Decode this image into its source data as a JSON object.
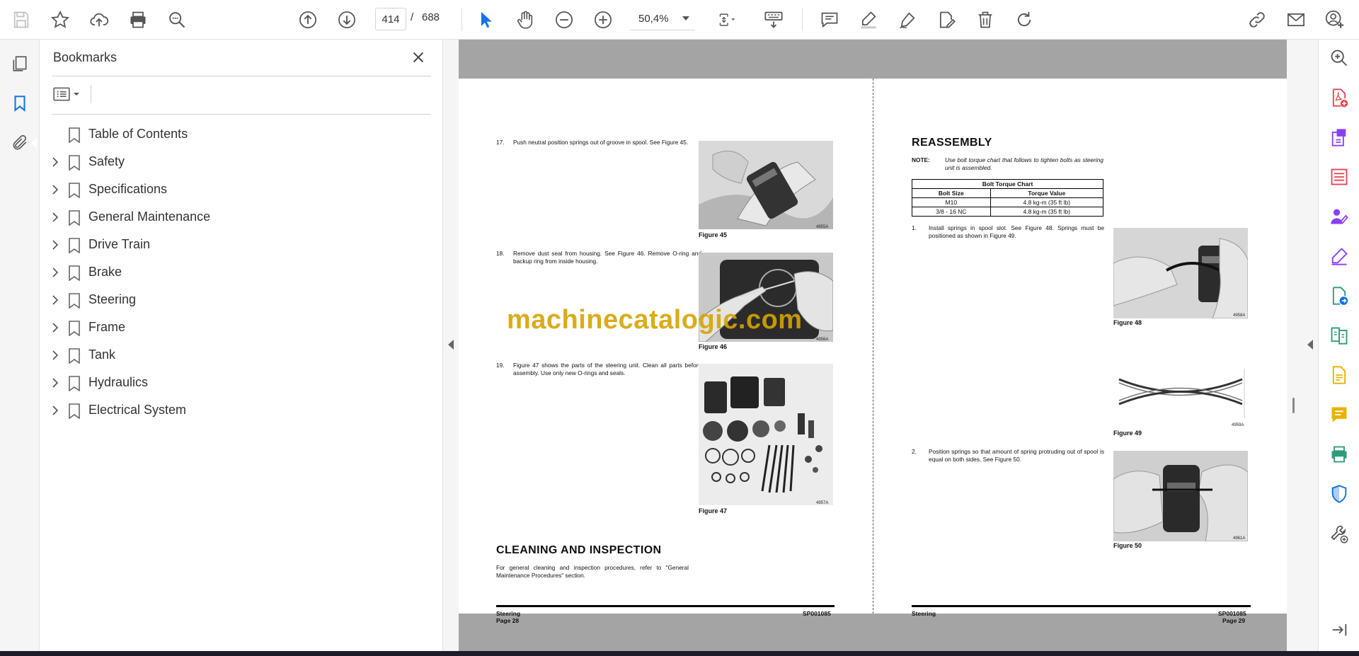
{
  "toolbar": {
    "current_page": "414",
    "page_separator": "/",
    "total_pages": "688",
    "zoom": "50,4%"
  },
  "bookmarks": {
    "title": "Bookmarks",
    "items": [
      {
        "label": "Table of Contents",
        "expandable": false
      },
      {
        "label": "Safety",
        "expandable": true
      },
      {
        "label": "Specifications",
        "expandable": true
      },
      {
        "label": "General Maintenance",
        "expandable": true
      },
      {
        "label": "Drive Train",
        "expandable": true
      },
      {
        "label": "Brake",
        "expandable": true
      },
      {
        "label": "Steering",
        "expandable": true
      },
      {
        "label": "Frame",
        "expandable": true
      },
      {
        "label": "Tank",
        "expandable": true
      },
      {
        "label": "Hydraulics",
        "expandable": true
      },
      {
        "label": "Electrical System",
        "expandable": true
      }
    ]
  },
  "document": {
    "left_page": {
      "step17_num": "17.",
      "step17_text": "Push neutral position springs out of groove in spool. See Figure 45.",
      "fig45_caption": "Figure 45",
      "fig45_code": "4955A",
      "step18_num": "18.",
      "step18_text": "Remove dust seal from housing. See Figure 46. Remove O-ring and backup ring from inside housing.",
      "fig46_caption": "Figure 46",
      "fig46_code": "4956A",
      "step19_num": "19.",
      "step19_text": "Figure 47 shows the parts of the steering unit. Clean all parts before assembly. Use only new O-rings and seals.",
      "fig47_caption": "Figure 47",
      "fig47_code": "4957A",
      "heading": "CLEANING AND INSPECTION",
      "cleaning_text": "For general cleaning and inspection procedures, refer to \"General Maintenance Procedures\" section.",
      "footer_section": "Steering",
      "footer_page": "Page 28",
      "footer_code": "SP001085"
    },
    "right_page": {
      "heading": "REASSEMBLY",
      "note_label": "NOTE:",
      "note_text": "Use bolt torque chart that follows to tighten bolts as steering unit is assembled.",
      "table_title": "Bolt Torque Chart",
      "table_headers": [
        "Bolt Size",
        "Torque Value"
      ],
      "table_rows": [
        [
          "M10",
          "4.8 kg-m (35 ft lb)"
        ],
        [
          "3/8 - 16 NC",
          "4.8 kg-m (35 ft lb)"
        ]
      ],
      "step1_num": "1.",
      "step1_text": "Install springs in spool slot. See Figure 48. Springs must be positioned as shown in Figure 49.",
      "fig48_caption": "Figure 48",
      "fig48_code": "4958A",
      "fig49_caption": "Figure 49",
      "fig49_code": "4959A",
      "step2_num": "2.",
      "step2_text": "Position springs so that amount of spring protruding out of spool is equal on both sides. See Figure 50.",
      "fig50_caption": "Figure 50",
      "fig50_code": "4961A",
      "footer_section": "Steering",
      "footer_page": "Page 29",
      "footer_code": "SP001085"
    },
    "watermark": "machinecatalogic.com"
  },
  "colors": {
    "accent_blue": "#1473e6",
    "tool_purple": "#8a3ffc",
    "tool_red": "#e34850",
    "tool_green": "#2d9d78",
    "tool_yellow": "#e8b100",
    "watermark": "#d6a400"
  }
}
